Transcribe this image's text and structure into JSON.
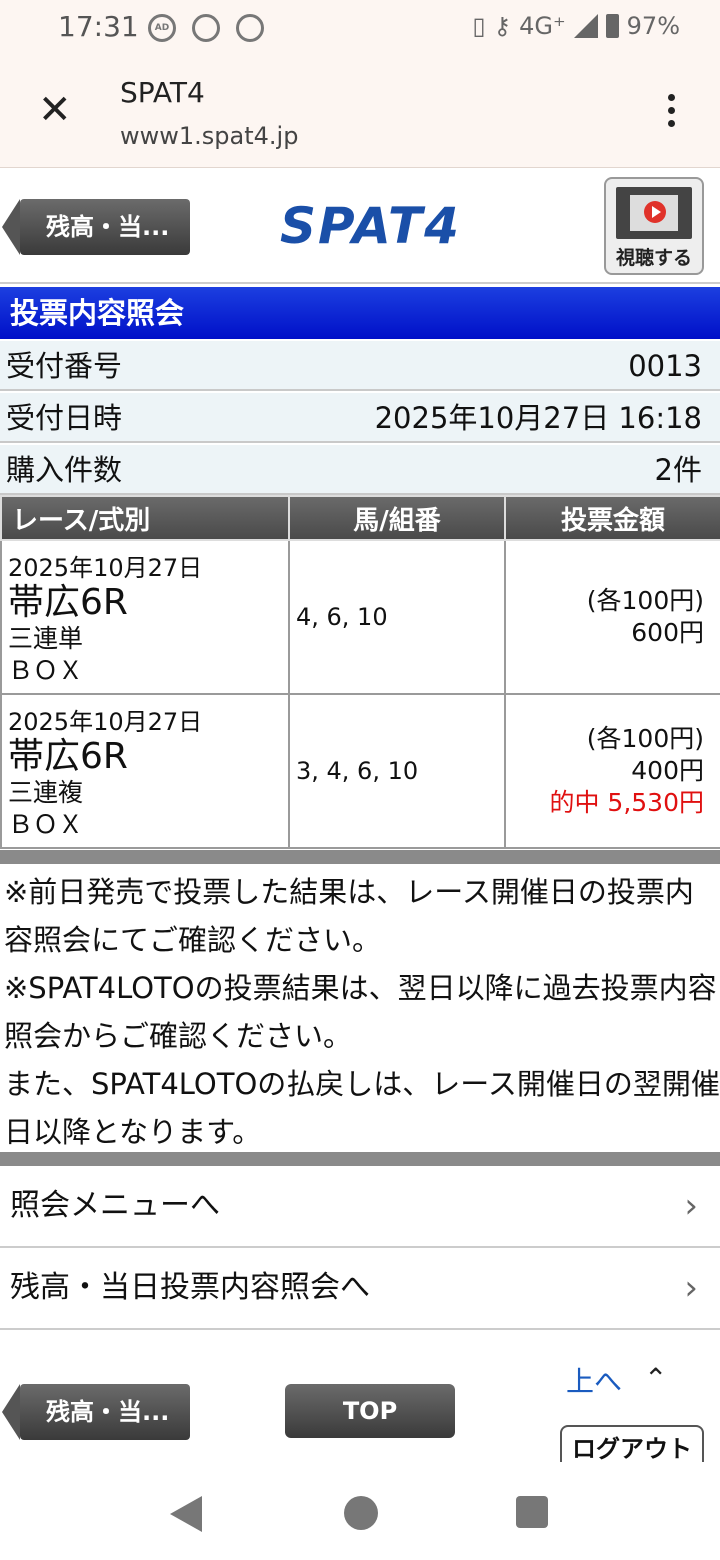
{
  "status": {
    "time": "17:31",
    "network": "4G⁺",
    "battery": "97%"
  },
  "browser": {
    "title": "SPAT4",
    "url": "www1.spat4.jp"
  },
  "header": {
    "back_label": "残高・当...",
    "logo": "SPAT4",
    "watch_label": "視聴する"
  },
  "section": {
    "title": "投票内容照会"
  },
  "info": [
    {
      "label": "受付番号",
      "value": "0013"
    },
    {
      "label": "受付日時",
      "value": "2025年10月27日 16:18"
    },
    {
      "label": "購入件数",
      "value": "2件"
    }
  ],
  "table": {
    "headers": [
      "レース/式別",
      "馬/組番",
      "投票金額"
    ],
    "rows": [
      {
        "date": "2025年10月27日",
        "race": "帯広6R",
        "bet_type": "三連単",
        "method": "ＢＯＸ",
        "horses": "4, 6, 10",
        "unit": "(各100円)",
        "amount": "600円",
        "hit": ""
      },
      {
        "date": "2025年10月27日",
        "race": "帯広6R",
        "bet_type": "三連複",
        "method": "ＢＯＸ",
        "horses": "3, 4, 6, 10",
        "unit": "(各100円)",
        "amount": "400円",
        "hit": "的中 5,530円"
      }
    ]
  },
  "notes": [
    "※前日発売で投票した結果は、レース開催日の投票内容照会にてご確認ください。",
    "※SPAT4LOTOの投票結果は、翌日以降に過去投票内容照会からご確認ください。",
    "また、SPAT4LOTOの払戻しは、レース開催日の翌開催日以降となります。"
  ],
  "links": [
    {
      "label": "照会メニューへ"
    },
    {
      "label": "残高・当日投票内容照会へ"
    }
  ],
  "footer": {
    "up_label": "上へ",
    "back_label": "残高・当...",
    "top_label": "TOP",
    "logout_label": "ログアウト"
  },
  "colors": {
    "section_title_bg": "#0010c8",
    "hit_text": "#e01010",
    "logo": "#1a4fa8"
  }
}
